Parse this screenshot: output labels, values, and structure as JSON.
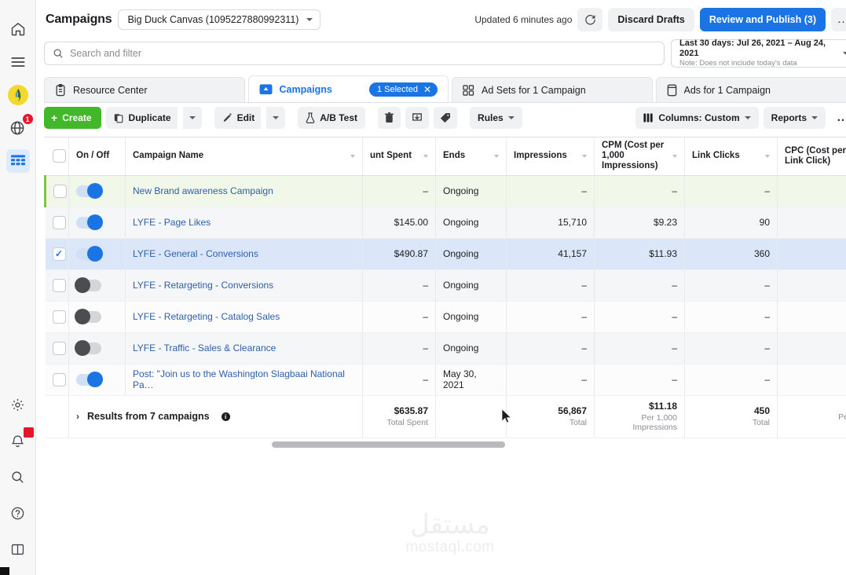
{
  "rail": {
    "top_items": [
      {
        "name": "home-icon",
        "label": "Home"
      },
      {
        "name": "menu-icon",
        "label": "All Tools"
      },
      {
        "name": "avatar-icon",
        "label": "Account"
      },
      {
        "name": "globe-icon",
        "label": "Notifications",
        "badge": "1"
      },
      {
        "name": "table-icon",
        "label": "Ads Manager",
        "active": true
      }
    ],
    "bottom_items": [
      {
        "name": "gear-icon",
        "label": "Settings"
      },
      {
        "name": "bell-icon",
        "label": "Alerts",
        "badge": ""
      },
      {
        "name": "search-icon",
        "label": "Search"
      },
      {
        "name": "help-icon",
        "label": "Help"
      },
      {
        "name": "panel-icon",
        "label": "Layout"
      }
    ]
  },
  "header": {
    "title": "Campaigns",
    "account": "Big Duck Canvas (1095227880992311)",
    "updated": "Updated 6 minutes ago",
    "refresh_icon": "refresh-icon",
    "discard_label": "Discard Drafts",
    "publish_label": "Review and Publish (3)",
    "more_label": "…"
  },
  "search": {
    "placeholder": "Search and filter",
    "value": "",
    "icon": "search-icon"
  },
  "daterange": {
    "line1": "Last 30 days: Jul 26, 2021  –  Aug 24, 2021",
    "line2": "Note: Does not include today's data"
  },
  "tabs": [
    {
      "label": "Resource Center",
      "icon": "clipboard-icon",
      "active": false
    },
    {
      "label": "Campaigns",
      "icon": "campaign-icon",
      "active": true,
      "pill": "1 Selected"
    },
    {
      "label": "Ad Sets for 1 Campaign",
      "icon": "adsets-icon",
      "active": false
    },
    {
      "label": "Ads for 1 Campaign",
      "icon": "ads-icon",
      "active": false
    }
  ],
  "toolbar": {
    "create_label": "Create",
    "duplicate_label": "Duplicate",
    "edit_label": "Edit",
    "abtest_label": "A/B Test",
    "delete_icon": "trash-icon",
    "export_icon": "export-icon",
    "tag_icon": "tag-icon",
    "rules_label": "Rules",
    "columns_label": "Columns: Custom",
    "reports_label": "Reports",
    "overflow_label": "…"
  },
  "table": {
    "columns": [
      {
        "key": "check",
        "label": "",
        "sortable": false,
        "align": "left"
      },
      {
        "key": "onoff",
        "label": "On / Off",
        "sortable": false,
        "align": "left"
      },
      {
        "key": "name",
        "label": "Campaign Name",
        "sortable": true,
        "align": "left"
      },
      {
        "key": "spent",
        "label": "unt Spent",
        "sortable": true,
        "align": "right"
      },
      {
        "key": "ends",
        "label": "Ends",
        "sortable": true,
        "align": "left"
      },
      {
        "key": "impr",
        "label": "Impressions",
        "sortable": true,
        "align": "right"
      },
      {
        "key": "cpm",
        "label": "CPM (Cost per 1,000 Impressions)",
        "sortable": true,
        "align": "right"
      },
      {
        "key": "clicks",
        "label": "Link Clicks",
        "sortable": true,
        "align": "right"
      },
      {
        "key": "cpc",
        "label": "CPC (Cost per Link Click)",
        "sortable": false,
        "align": "right"
      }
    ],
    "rows": [
      {
        "checked": false,
        "on": true,
        "draft": true,
        "name": "New Brand awareness Campaign",
        "spent": "–",
        "ends": "Ongoing",
        "impr": "–",
        "cpm": "–",
        "clicks": "–",
        "cpc": ""
      },
      {
        "checked": false,
        "on": true,
        "draft": false,
        "name": "LYFE - Page Likes",
        "spent": "$145.00",
        "ends": "Ongoing",
        "impr": "15,710",
        "cpm": "$9.23",
        "clicks": "90",
        "cpc": ""
      },
      {
        "checked": true,
        "on": true,
        "draft": false,
        "name": "LYFE - General - Conversions",
        "spent": "$490.87",
        "ends": "Ongoing",
        "impr": "41,157",
        "cpm": "$11.93",
        "clicks": "360",
        "cpc": ""
      },
      {
        "checked": false,
        "on": false,
        "draft": false,
        "name": "LYFE - Retargeting - Conversions",
        "spent": "–",
        "ends": "Ongoing",
        "impr": "–",
        "cpm": "–",
        "clicks": "–",
        "cpc": ""
      },
      {
        "checked": false,
        "on": false,
        "draft": false,
        "name": "LYFE - Retargeting - Catalog Sales",
        "spent": "–",
        "ends": "Ongoing",
        "impr": "–",
        "cpm": "–",
        "clicks": "–",
        "cpc": ""
      },
      {
        "checked": false,
        "on": false,
        "draft": false,
        "name": "LYFE - Traffic - Sales & Clearance",
        "spent": "–",
        "ends": "Ongoing",
        "impr": "–",
        "cpm": "–",
        "clicks": "–",
        "cpc": ""
      },
      {
        "checked": false,
        "on": true,
        "draft": false,
        "name": "Post: \"Join us to the Washington Slagbaai National Pa…",
        "spent": "–",
        "ends": "May 30, 2021",
        "impr": "–",
        "cpm": "–",
        "clicks": "–",
        "cpc": ""
      }
    ],
    "summary": {
      "label": "Results from 7 campaigns",
      "spent": "$635.87",
      "spent_sub": "Total Spent",
      "ends": "",
      "ends_sub": "",
      "impr": "56,867",
      "impr_sub": "Total",
      "cpm": "$11.18",
      "cpm_sub": "Per 1,000 Impressions",
      "clicks": "450",
      "clicks_sub": "Total",
      "cpc": "",
      "cpc_sub": "Pe"
    }
  },
  "watermark": {
    "arabic": "مستقل",
    "latin": "mostaql.com"
  },
  "colors": {
    "accent_blue": "#1b74e4",
    "create_green": "#42b72a",
    "draft_green": "#7bc34a",
    "badge_red": "#e4172b",
    "link_blue": "#2d5fa8"
  }
}
